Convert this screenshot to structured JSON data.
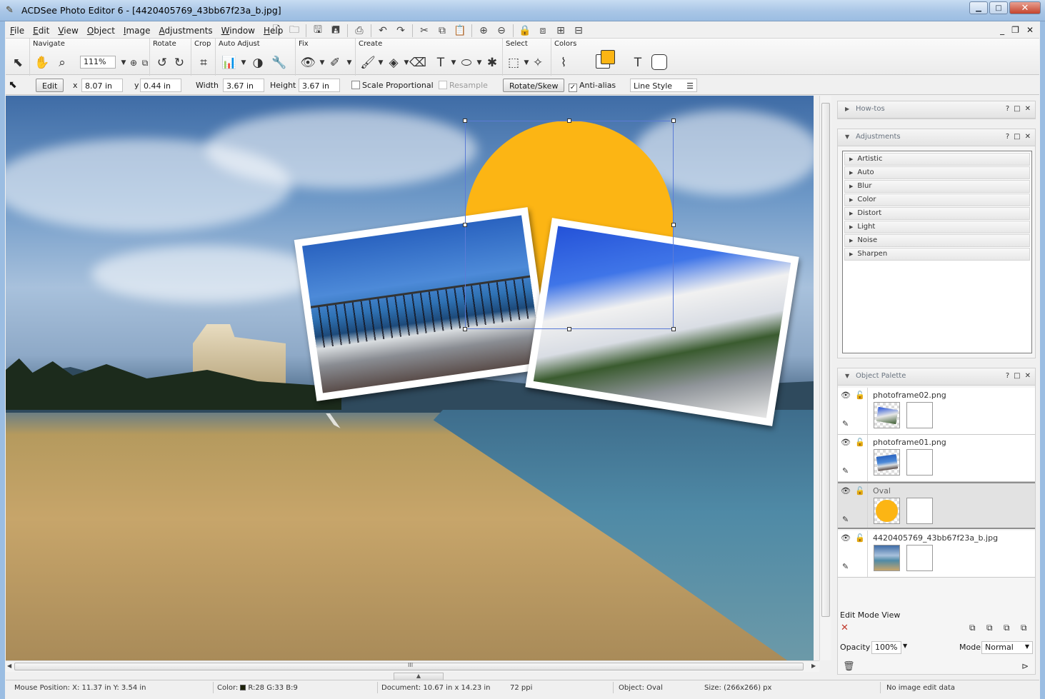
{
  "window": {
    "title": "ACDSee Photo Editor 6 - [4420405769_43bb67f23a_b.jpg]",
    "minimize": "▁",
    "maximize": "□",
    "close": "✕"
  },
  "menu": {
    "items": [
      "File",
      "Edit",
      "View",
      "Object",
      "Image",
      "Adjustments",
      "Window",
      "Help"
    ],
    "mdi_minimize": "_",
    "mdi_restore": "❐",
    "mdi_close": "✕"
  },
  "toolbar": {
    "groups": {
      "navigate": "Navigate",
      "rotate": "Rotate",
      "crop": "Crop",
      "auto_adjust": "Auto Adjust",
      "fix": "Fix",
      "create": "Create",
      "select": "Select",
      "colors": "Colors"
    },
    "zoom_value": "111%",
    "accent_color": "#fcb514"
  },
  "propbar": {
    "edit_button": "Edit",
    "x_label": "x",
    "x_value": "8.07 in",
    "y_label": "y",
    "y_value": "0.44 in",
    "width_label": "Width",
    "width_value": "3.67 in",
    "height_label": "Height",
    "height_value": "3.67 in",
    "scale_proportional": "Scale Proportional",
    "resample": "Resample",
    "rotate_skew": "Rotate/Skew",
    "anti_alias": "Anti-alias",
    "anti_alias_checked": "✓",
    "line_style": "Line Style"
  },
  "panels": {
    "howtos": "How-tos",
    "adjustments": "Adjustments",
    "object_palette": "Object Palette",
    "help": "?",
    "restore": "□",
    "close": "✕",
    "adjustment_items": [
      "Artistic",
      "Auto",
      "Blur",
      "Color",
      "Distort",
      "Light",
      "Noise",
      "Sharpen"
    ],
    "objects": [
      {
        "name": "photoframe02.png",
        "selected": false
      },
      {
        "name": "photoframe01.png",
        "selected": false
      },
      {
        "name": "Oval",
        "selected": true
      },
      {
        "name": "4420405769_43bb67f23a_b.jpg",
        "selected": false
      }
    ],
    "edit_mode_view": "Edit Mode View",
    "opacity_label": "Opacity",
    "opacity_value": "100%",
    "mode_label": "Mode",
    "mode_value": "Normal"
  },
  "status": {
    "mouse_position": "Mouse Position: X: 11.37 in    Y: 3.54 in",
    "color_label": "Color:",
    "color_values": "R:28  G:33  B:9",
    "document": "Document: 10.67 in x 14.23 in",
    "ppi": "72 ppi",
    "object": "Object: Oval",
    "size": "Size: (266x266) px",
    "edit_data": "No image edit data"
  },
  "scroll": {
    "grip": "III"
  }
}
